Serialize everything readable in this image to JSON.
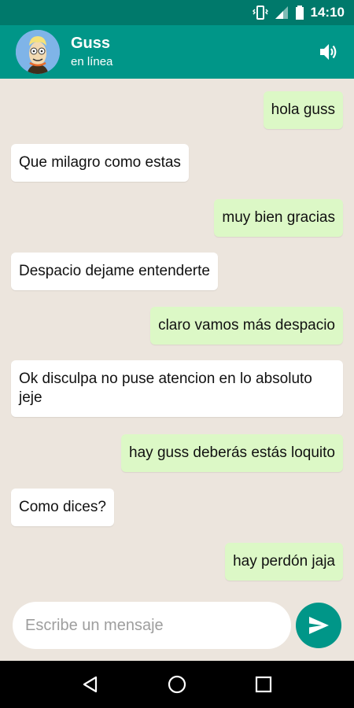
{
  "status_bar": {
    "time": "14:10",
    "icons": [
      "vibrate-icon",
      "signal-icon",
      "battery-icon"
    ]
  },
  "header": {
    "contact_name": "Guss",
    "contact_status": "en línea",
    "icons": [
      "avatar",
      "speaker-icon"
    ]
  },
  "messages": [
    {
      "direction": "out",
      "text": "hola guss"
    },
    {
      "direction": "in",
      "text": "Que milagro como estas"
    },
    {
      "direction": "out",
      "text": "muy bien gracias"
    },
    {
      "direction": "in",
      "text": "Despacio dejame entenderte"
    },
    {
      "direction": "out",
      "text": "claro vamos más despacio"
    },
    {
      "direction": "in",
      "text": "Ok disculpa no puse atencion en lo absoluto jeje"
    },
    {
      "direction": "out",
      "text": "hay guss deberás estás loquito"
    },
    {
      "direction": "in",
      "text": "Como dices?"
    },
    {
      "direction": "out",
      "text": "hay perdón jaja"
    }
  ],
  "composer": {
    "placeholder": "Escribe un mensaje",
    "value": "",
    "send_icon": "send-icon"
  },
  "nav_bar": {
    "icons": [
      "back-icon",
      "home-icon",
      "recents-icon"
    ]
  },
  "colors": {
    "primary": "#009688",
    "primary_dark": "#00796B",
    "chat_background": "#ECE5DD",
    "outgoing_bubble": "#DCF8C6",
    "incoming_bubble": "#FFFFFF"
  }
}
